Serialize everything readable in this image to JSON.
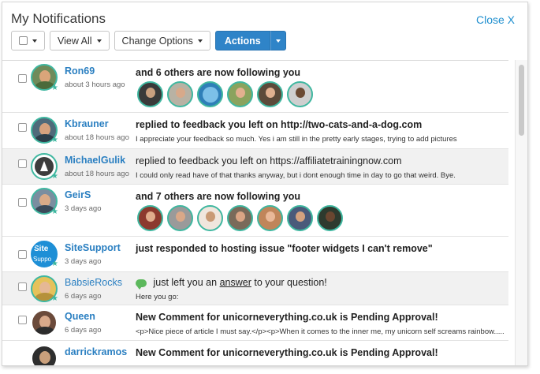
{
  "header": {
    "title": "My Notifications",
    "close_label": "Close X"
  },
  "toolbar": {
    "view_all_label": "View All",
    "change_options_label": "Change Options",
    "actions_label": "Actions"
  },
  "notifications": [
    {
      "user": "Ron69",
      "time": "about 3 hours ago",
      "action": "and 6 others are now following you",
      "detail": ""
    },
    {
      "user": "Kbrauner",
      "time": "about 18 hours ago",
      "action": "replied to feedback you left on http://two-cats-and-a-dog.com",
      "detail": "I appreciate your feedback so much. Yes i am still in the pretty early stages, trying to add pictures"
    },
    {
      "user": "MichaelGulik",
      "time": "about 18 hours ago",
      "action": "replied to feedback you left on https://affiliatetrainingnow.com",
      "detail": "I could only read have of that thanks anyway, but i dont enough time in day to go that weird. Bye."
    },
    {
      "user": "GeirS",
      "time": "3 days ago",
      "action": "and 7 others are now following you",
      "detail": ""
    },
    {
      "user": "SiteSupport",
      "time": "3 days ago",
      "action": "just responded to hosting issue \"footer widgets I can't remove\"",
      "detail": ""
    },
    {
      "user": "BabsieRocks",
      "time": "6 days ago",
      "action_pre": "just left you an",
      "action_link": "answer",
      "action_post": "to your question!",
      "detail": "Here you go:"
    },
    {
      "user": "Queen",
      "time": "6 days ago",
      "action": "New Comment for unicorneverything.co.uk is Pending Approval!",
      "detail": "<p>Nice piece of article I must say.</p><p>When it comes to the inner me, my unicorn self screams rainbow....."
    },
    {
      "user": "darrickramos",
      "time": "",
      "action": "New Comment for unicorneverything.co.uk is Pending Approval!",
      "detail": ""
    }
  ],
  "avatar_text": {
    "site": "Site",
    "support": "Suppo"
  },
  "colors": {
    "accent": "#2f84c8",
    "link": "#2a7fc1",
    "ring": "#3fb7a0",
    "row_alt": "#f1f1f1"
  }
}
